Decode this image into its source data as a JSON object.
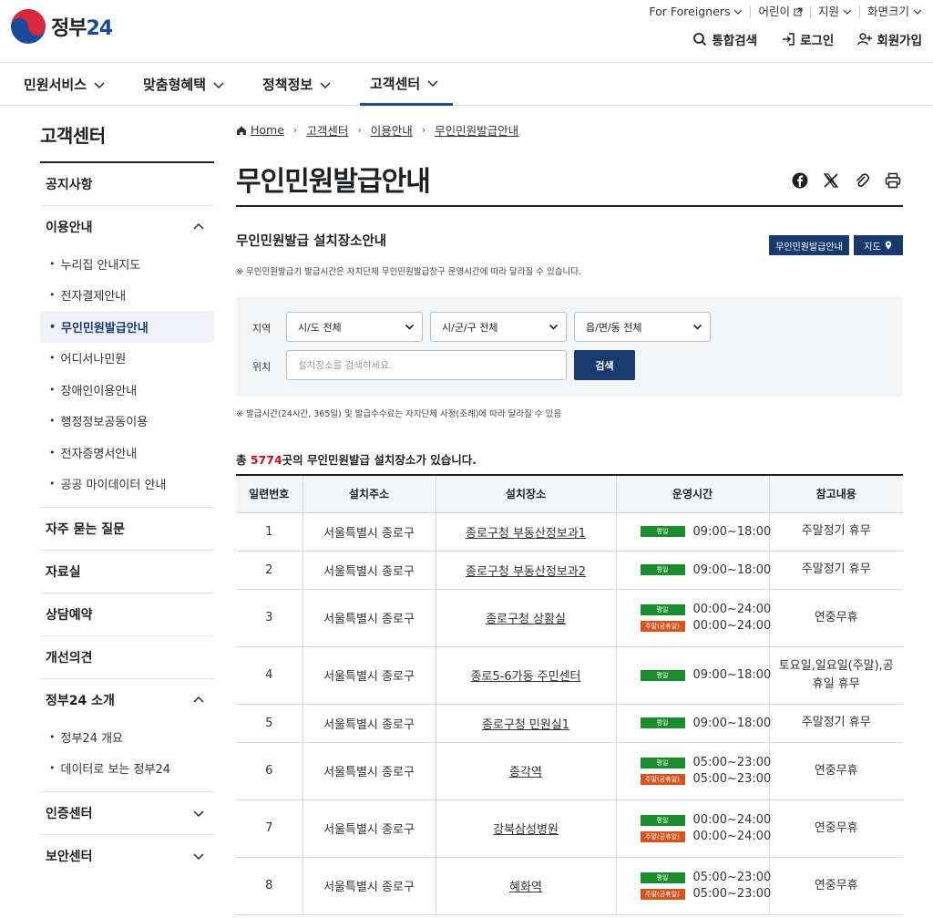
{
  "header": {
    "logo_text": "정부",
    "logo_num": "24",
    "util": [
      "For Foreigners",
      "어린이",
      "지원",
      "화면크기"
    ],
    "actions": [
      "통합검색",
      "로그인",
      "회원가입"
    ]
  },
  "gnb": [
    "민원서비스",
    "맞춤형혜택",
    "정책정보",
    "고객센터"
  ],
  "sidebar": {
    "title": "고객센터",
    "sections": [
      {
        "label": "공지사항"
      },
      {
        "label": "이용안내",
        "items": [
          "누리집 안내지도",
          "전자결제안내",
          "무인민원발급안내",
          "어디서나민원",
          "장애인이용안내",
          "행정정보공동이용",
          "전자증명서안내",
          "공공 마이데이터 안내"
        ]
      },
      {
        "label": "자주 묻는 질문"
      },
      {
        "label": "자료실"
      },
      {
        "label": "상담예약"
      },
      {
        "label": "개선의견"
      },
      {
        "label": "정부24 소개",
        "items": [
          "정부24 개요",
          "데이터로 보는 정부24"
        ]
      },
      {
        "label": "인증센터"
      },
      {
        "label": "보안센터"
      }
    ]
  },
  "breadcrumb": [
    "Home",
    "고객센터",
    "이용안내",
    "무인민원발급안내"
  ],
  "page_title": "무인민원발급안내",
  "section_title": "무인민원발급 설치장소안내",
  "buttons": {
    "guide": "무인민원발급안내",
    "map": "지도"
  },
  "note1": "※ 무인민원발급기 발급시간은 자치단체 무인민원발급창구 운영시간에 따라 달라질 수 있습니다.",
  "search": {
    "region_label": "지역",
    "location_label": "위치",
    "sido": "시/도 전체",
    "sigungu": "시/군/구 전체",
    "eupmyeondong": "읍/면/동 전체",
    "placeholder": "설치장소를 검색하세요.",
    "button": "검색"
  },
  "note2": "※ 발급시간(24시간, 365일) 및 발급수수료는 자치단체 사정(조례)에 따라 달라질 수 있음",
  "total": {
    "prefix": "총 ",
    "count": "5774",
    "suffix": "곳의 무인민원발급 설치장소가 있습니다."
  },
  "table": {
    "headers": [
      "일련번호",
      "설치주소",
      "설치장소",
      "운영시간",
      "참고내용"
    ],
    "tag_weekday": "평일",
    "tag_weekend": "주말(공휴일)",
    "rows": [
      {
        "no": "1",
        "addr": "서울특별시 종로구",
        "place": "종로구청 부동산정보과1",
        "weekday": "09:00~18:00",
        "weekend": "",
        "remark": "주말정기 휴무"
      },
      {
        "no": "2",
        "addr": "서울특별시 종로구",
        "place": "종로구청 부동산정보과2",
        "weekday": "09:00~18:00",
        "weekend": "",
        "remark": "주말정기 휴무"
      },
      {
        "no": "3",
        "addr": "서울특별시 종로구",
        "place": "종로구청 상황실",
        "weekday": "00:00~24:00",
        "weekend": "00:00~24:00",
        "remark": "연중무휴"
      },
      {
        "no": "4",
        "addr": "서울특별시 종로구",
        "place": "종로5-6가동 주민센터",
        "weekday": "09:00~18:00",
        "weekend": "",
        "remark": "토요일,일요일(주말),공휴일 휴무"
      },
      {
        "no": "5",
        "addr": "서울특별시 종로구",
        "place": "종로구청 민원실1",
        "weekday": "09:00~18:00",
        "weekend": "",
        "remark": "주말정기 휴무"
      },
      {
        "no": "6",
        "addr": "서울특별시 종로구",
        "place": "종각역",
        "weekday": "05:00~23:00",
        "weekend": "05:00~23:00",
        "remark": "연중무휴"
      },
      {
        "no": "7",
        "addr": "서울특별시 종로구",
        "place": "강북삼성병원",
        "weekday": "00:00~24:00",
        "weekend": "00:00~24:00",
        "remark": "연중무휴"
      },
      {
        "no": "8",
        "addr": "서울특별시 종로구",
        "place": "혜화역",
        "weekday": "05:00~23:00",
        "weekend": "05:00~23:00",
        "remark": "연중무휴"
      }
    ]
  }
}
